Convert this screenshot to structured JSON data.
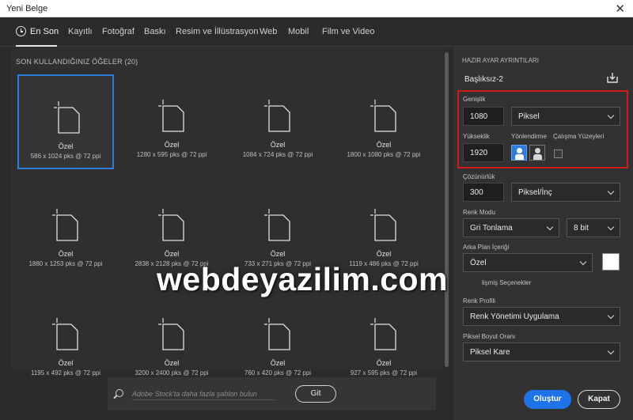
{
  "window": {
    "title": "Yeni Belge",
    "close_glyph": "✕"
  },
  "tabs": [
    {
      "label": "En Son",
      "active": true
    },
    {
      "label": "Kayıtlı"
    },
    {
      "label": "Fotoğraf"
    },
    {
      "label": "Baskı"
    },
    {
      "label": "Resim ve İllüstrasyon"
    },
    {
      "label": "Web"
    },
    {
      "label": "Mobil"
    },
    {
      "label": "Film ve Video"
    }
  ],
  "recent": {
    "section_title": "SON KULLANDIĞINIZ ÖĞELER",
    "count": "(20)",
    "items": [
      {
        "name": "Özel",
        "dims": "586 x 1024 pks @ 72 ppi",
        "selected": true
      },
      {
        "name": "Özel",
        "dims": "1280 x 595 pks @ 72 ppi"
      },
      {
        "name": "Özel",
        "dims": "1084 x 724 pks @ 72 ppi"
      },
      {
        "name": "Özel",
        "dims": "1800 x 1080 pks @ 72 ppi"
      },
      {
        "name": "Özel",
        "dims": "1880 x 1253 pks @ 72 ppi"
      },
      {
        "name": "Özel",
        "dims": "2838 x 2128 pks @ 72 ppi"
      },
      {
        "name": "Özel",
        "dims": "733 x 271 pks @ 72 ppi"
      },
      {
        "name": "Özel",
        "dims": "1119 x 486 pks @ 72 ppi"
      },
      {
        "name": "Özel",
        "dims": "1195 x 492 pks @ 72 ppi"
      },
      {
        "name": "Özel",
        "dims": "3200 x 2400 pks @ 72 ppi"
      },
      {
        "name": "Özel",
        "dims": "760 x 420 pks @ 72 ppi"
      },
      {
        "name": "Özel",
        "dims": "927 x 595 pks @ 72 ppi"
      }
    ]
  },
  "search": {
    "placeholder": "Adobe Stock'ta daha fazla şablon bulun",
    "button_label": "Git"
  },
  "details": {
    "header": "HAZIR AYAR AYRINTILARI",
    "doc_name": "Başlıksız-2",
    "width_label": "Genişlik",
    "width_value": "1080",
    "unit_value": "Piksel",
    "height_label": "Yükseklik",
    "height_value": "1920",
    "orientation_label": "Yönlendirme",
    "artboards_label": "Çalışma Yüzeyleri",
    "resolution_label": "Çözünürlük",
    "resolution_value": "300",
    "resolution_unit": "Piksel/İnç",
    "color_mode_label": "Renk Modu",
    "color_mode_value": "Gri Tonlama",
    "bit_depth": "8 bit",
    "background_label": "Arka Plan İçeriği",
    "background_value": "Özel",
    "background_color": "#ffffff",
    "advanced_label": "lişmiş Seçenekler",
    "color_profile_label": "Renk Profili",
    "color_profile_value": "Renk Yönetimi Uygulama",
    "pixel_aspect_label": "Piksel Boyut Oranı",
    "pixel_aspect_value": "Piksel Kare"
  },
  "actions": {
    "create_label": "Oluştur",
    "close_label": "Kapat"
  },
  "watermark": "webdeyazilim.com",
  "colors": {
    "accent": "#1f73e8",
    "selection": "#2f7bdc",
    "highlight_box": "#d11b1b"
  }
}
